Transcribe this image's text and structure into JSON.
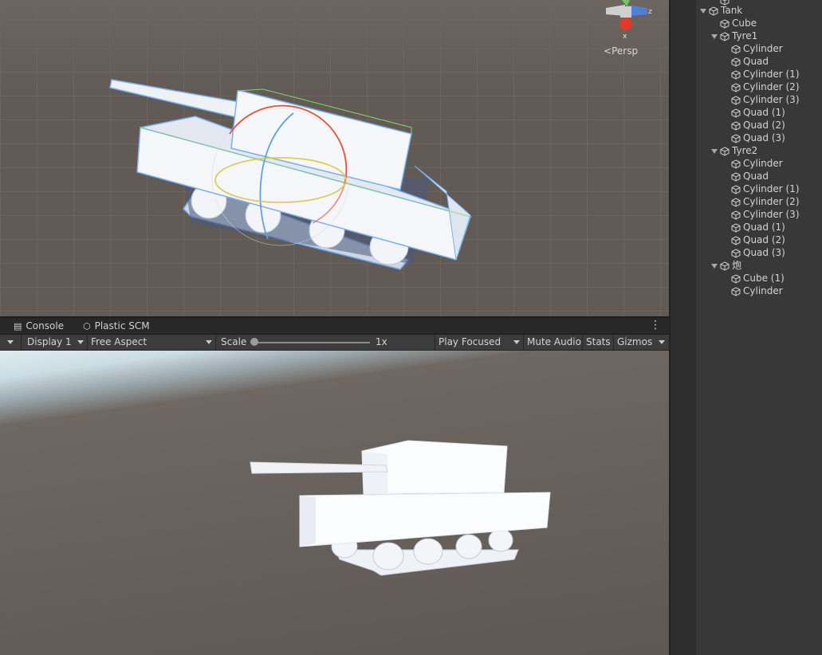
{
  "scene": {
    "view_mode": "Persp",
    "gizmo_axes": {
      "x": "x",
      "z": "z"
    }
  },
  "tabs": [
    {
      "label": "Console",
      "icon": "console-icon"
    },
    {
      "label": "Plastic SCM",
      "icon": "plastic-scm-icon"
    }
  ],
  "game_toolbar": {
    "display": "Display 1",
    "aspect": "Free Aspect",
    "scale_label": "Scale",
    "scale_value": "1x",
    "play_mode": "Play Focused",
    "mute_audio": "Mute Audio",
    "stats": "Stats",
    "gizmos": "Gizmos"
  },
  "hierarchy": {
    "items": [
      {
        "label": "Tank",
        "level": 0,
        "expanded": true
      },
      {
        "label": "Cube",
        "level": 1
      },
      {
        "label": "Tyre1",
        "level": 1,
        "expanded": true
      },
      {
        "label": "Cylinder",
        "level": 2
      },
      {
        "label": "Quad",
        "level": 2
      },
      {
        "label": "Cylinder (1)",
        "level": 2
      },
      {
        "label": "Cylinder (2)",
        "level": 2
      },
      {
        "label": "Cylinder (3)",
        "level": 2
      },
      {
        "label": "Quad (1)",
        "level": 2
      },
      {
        "label": "Quad (2)",
        "level": 2
      },
      {
        "label": "Quad (3)",
        "level": 2
      },
      {
        "label": "Tyre2",
        "level": 1,
        "expanded": true
      },
      {
        "label": "Cylinder",
        "level": 2
      },
      {
        "label": "Quad",
        "level": 2
      },
      {
        "label": "Cylinder (1)",
        "level": 2
      },
      {
        "label": "Cylinder (2)",
        "level": 2
      },
      {
        "label": "Cylinder (3)",
        "level": 2
      },
      {
        "label": "Quad (1)",
        "level": 2
      },
      {
        "label": "Quad (2)",
        "level": 2
      },
      {
        "label": "Quad (3)",
        "level": 2
      },
      {
        "label": "炮",
        "level": 1,
        "expanded": true
      },
      {
        "label": "Cube (1)",
        "level": 2
      },
      {
        "label": "Cylinder",
        "level": 2
      }
    ]
  },
  "colors": {
    "selection_outline": "#4aa3ff",
    "rotate_x": "#e0543a",
    "rotate_y": "#5fa0e0",
    "rotate_z": "#d8c84a"
  }
}
